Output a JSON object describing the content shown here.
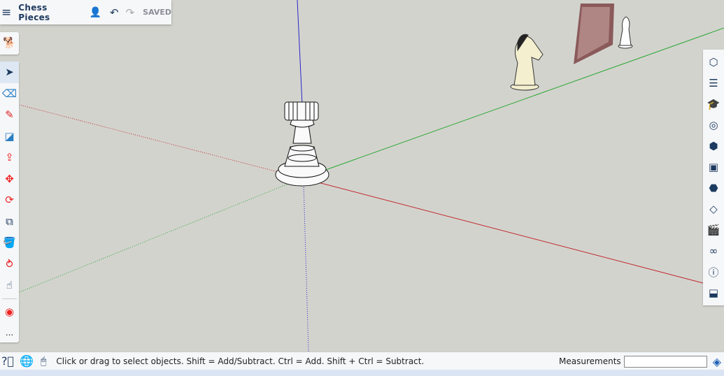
{
  "header": {
    "title": "Chess Pieces",
    "status": "SAVED"
  },
  "icons": {
    "menu": "hamburger-icon",
    "share": "add-user-icon",
    "undo": "undo-icon",
    "redo": "redo-icon"
  },
  "left_toolbar": {
    "top": [
      {
        "name": "search-tool"
      }
    ],
    "tools": [
      {
        "name": "select"
      },
      {
        "name": "eraser"
      },
      {
        "name": "pencil"
      },
      {
        "name": "rectangle"
      },
      {
        "name": "push-pull"
      },
      {
        "name": "move"
      },
      {
        "name": "rotate"
      },
      {
        "name": "scale"
      },
      {
        "name": "paint-bucket"
      },
      {
        "name": "orbit"
      },
      {
        "name": "pan"
      },
      {
        "name": "tape-measure"
      },
      {
        "name": "more"
      }
    ],
    "more_label": "..."
  },
  "right_toolbar": [
    "entity-info",
    "outliner",
    "instructor",
    "materials",
    "components",
    "styles",
    "scenes-solid",
    "tags",
    "animation",
    "display",
    "info",
    "3d-warehouse"
  ],
  "status": {
    "message": "Click or drag to select objects. Shift = Add/Subtract. Ctrl = Add. Shift + Ctrl = Subtract.",
    "measurements_label": "Measurements",
    "measurements_value": ""
  },
  "colors": {
    "red_axis": "#c0292b",
    "green_axis": "#2aa832",
    "blue_axis": "#2828c8",
    "canvas": "#d3d3ce"
  }
}
